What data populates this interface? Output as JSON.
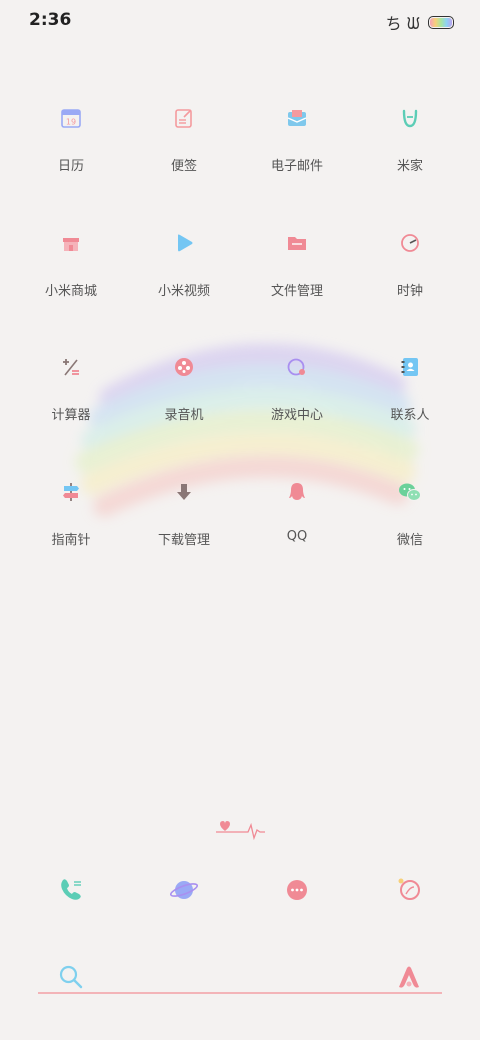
{
  "status_bar": {
    "time": "2:36",
    "glyphs": "ち ᙎ"
  },
  "apps": [
    {
      "label": "日历",
      "icon": "calendar-icon",
      "color": "#9aa9f5"
    },
    {
      "label": "便签",
      "icon": "notes-icon",
      "color": "#f49a9e"
    },
    {
      "label": "电子邮件",
      "icon": "mail-icon",
      "color": "#7fc8ec"
    },
    {
      "label": "米家",
      "icon": "mijia-icon",
      "color": "#5ccdb6"
    },
    {
      "label": "小米商城",
      "icon": "store-icon",
      "color": "#f08a95"
    },
    {
      "label": "小米视频",
      "icon": "video-icon",
      "color": "#74c6f3"
    },
    {
      "label": "文件管理",
      "icon": "folder-icon",
      "color": "#f08a95"
    },
    {
      "label": "时钟",
      "icon": "clock-icon",
      "color": "#f08a95"
    },
    {
      "label": "计算器",
      "icon": "calculator-icon",
      "color": "#8a7776"
    },
    {
      "label": "录音机",
      "icon": "recorder-icon",
      "color": "#f08a95"
    },
    {
      "label": "游戏中心",
      "icon": "game-center-icon",
      "color": "#a98ff0"
    },
    {
      "label": "联系人",
      "icon": "contacts-icon",
      "color": "#74c6f3"
    },
    {
      "label": "指南针",
      "icon": "compass-icon",
      "color": "#f08a95"
    },
    {
      "label": "下载管理",
      "icon": "download-icon",
      "color": "#8a7776"
    },
    {
      "label": "QQ",
      "icon": "qq-icon",
      "color": "#f08a95"
    },
    {
      "label": "微信",
      "icon": "wechat-icon",
      "color": "#6bd19a"
    }
  ],
  "dock": [
    {
      "icon": "phone-icon",
      "color": "#5ccdb6"
    },
    {
      "icon": "browser-icon",
      "color": "#9aa9f5"
    },
    {
      "icon": "messages-icon",
      "color": "#f08a95"
    },
    {
      "icon": "camera-icon",
      "color": "#f08a95"
    }
  ],
  "colors": {
    "background": "#f4f2f1",
    "accent_pink": "#f08a95",
    "search_line": "#f3b4b8",
    "search_icon": "#7fd0ee"
  }
}
